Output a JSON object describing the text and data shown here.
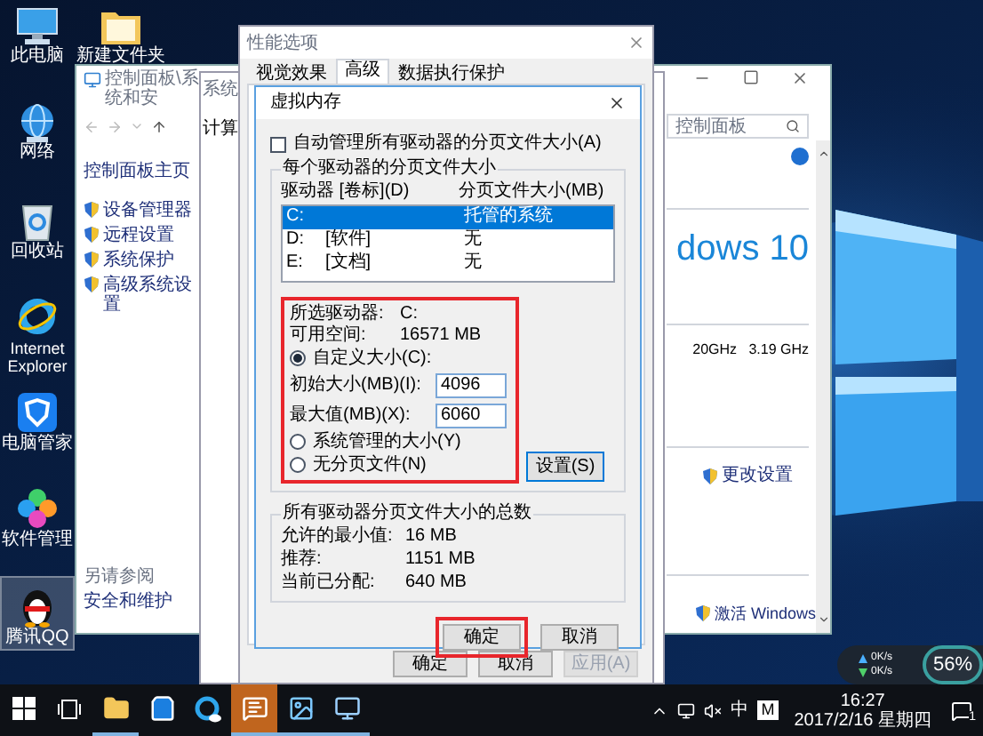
{
  "desktop_icons": [
    {
      "kind": "pc",
      "label": "此电脑",
      "selected": false
    },
    {
      "kind": "network",
      "label": "网络",
      "selected": false
    },
    {
      "kind": "recycle",
      "label": "回收站",
      "selected": false
    },
    {
      "kind": "ie",
      "label": "Internet Explorer",
      "selected": false
    },
    {
      "kind": "guard",
      "label": "电脑管家",
      "selected": false
    },
    {
      "kind": "apps",
      "label": "软件管理",
      "selected": false
    },
    {
      "kind": "qq",
      "label": "腾讯QQ",
      "selected": true
    },
    {
      "kind": "folder",
      "label": "新建文件夹",
      "selected": false
    }
  ],
  "control_panel": {
    "title": "控制面板\\系统和安",
    "search_placeholder": "控制面板",
    "links": [
      {
        "kind": "plain",
        "label": "控制面板主页"
      },
      {
        "kind": "shield",
        "label": "设备管理器"
      },
      {
        "kind": "shield",
        "label": "远程设置"
      },
      {
        "kind": "shield",
        "label": "系统保护"
      },
      {
        "kind": "shield",
        "label": "高级系统设置"
      }
    ],
    "see_also_title": "另请参阅",
    "see_also": [
      "安全和维护"
    ],
    "edition": "dows 10",
    "processor": "20GHz   3.19 GHz",
    "change_settings": "更改设置",
    "activate": "激活 Windows"
  },
  "system_properties": {
    "title": "系统",
    "tab": "计算"
  },
  "performance_options": {
    "title": "性能选项",
    "tabs": [
      {
        "label": "视觉效果",
        "selected": false
      },
      {
        "label": "高级",
        "selected": true
      },
      {
        "label": "数据执行保护",
        "selected": false
      }
    ],
    "buttons": [
      {
        "label": "确定",
        "disabled": false
      },
      {
        "label": "取消",
        "disabled": false
      },
      {
        "label": "应用(A)",
        "disabled": true
      }
    ]
  },
  "virtual_memory": {
    "title": "虚拟内存",
    "auto_manage": {
      "label": "自动管理所有驱动器的分页文件大小(A)",
      "checked": false
    },
    "drives_group": "每个驱动器的分页文件大小",
    "columns": [
      "驱动器 [卷标](D)",
      "分页文件大小(MB)"
    ],
    "drives": [
      {
        "drive": "C:",
        "size": "托管的系统",
        "selected": true
      },
      {
        "drive": "D:",
        "volume": "[软件]",
        "size": "无",
        "selected": false
      },
      {
        "drive": "E:",
        "volume": "[文档]",
        "size": "无",
        "selected": false
      }
    ],
    "selected_drive": {
      "label": "所选驱动器:",
      "value": "C:"
    },
    "free_space": {
      "label": "可用空间:",
      "value": "16571 MB"
    },
    "options": [
      {
        "label": "自定义大小(C):",
        "selected": true
      },
      {
        "label": "系统管理的大小(Y)",
        "selected": false
      },
      {
        "label": "无分页文件(N)",
        "selected": false
      }
    ],
    "size_fields": [
      {
        "label": "初始大小(MB)(I):",
        "value": "4096"
      },
      {
        "label": "最大值(MB)(X):",
        "value": "6060"
      }
    ],
    "set_button": "设置(S)",
    "totals_group": "所有驱动器分页文件大小的总数",
    "totals": [
      {
        "label": "允许的最小值:",
        "value": "16 MB"
      },
      {
        "label": "推荐:",
        "value": "1151 MB"
      },
      {
        "label": "当前已分配:",
        "value": "640 MB"
      }
    ],
    "buttons": [
      {
        "label": "确定",
        "highlighted": true
      },
      {
        "label": "取消",
        "highlighted": false
      }
    ]
  },
  "taskbar": {
    "apps": [
      {
        "kind": "start",
        "running": false,
        "selected": false
      },
      {
        "kind": "task-view",
        "running": false,
        "selected": false
      },
      {
        "kind": "explorer",
        "running": true,
        "selected": false
      },
      {
        "kind": "store",
        "running": false,
        "selected": false
      },
      {
        "kind": "browser",
        "running": false,
        "selected": false
      },
      {
        "kind": "chat",
        "running": true,
        "selected": true
      },
      {
        "kind": "photos",
        "running": true,
        "selected": false
      },
      {
        "kind": "system",
        "running": true,
        "selected": false
      }
    ],
    "ime": "中",
    "ime_mode": "M",
    "time": "16:27",
    "date": "2017/2/16 星期四",
    "notification_count": "1"
  },
  "net_monitor": {
    "upload": "0K/s",
    "download": "0K/s",
    "percent": "56%"
  }
}
